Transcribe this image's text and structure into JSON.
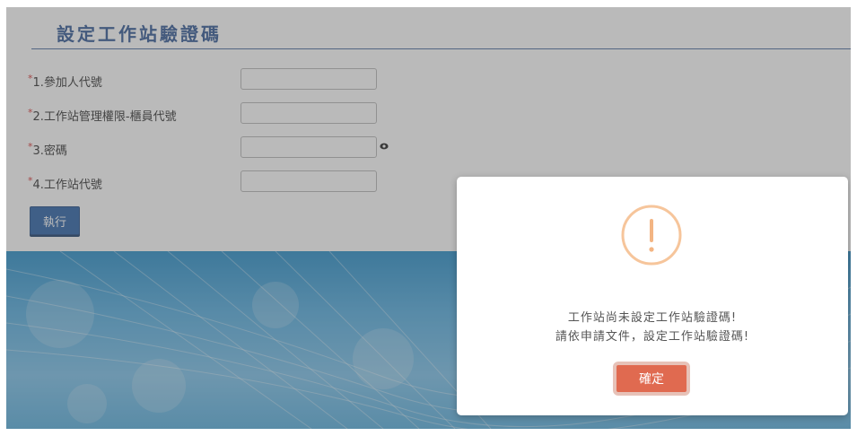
{
  "form": {
    "title": "設定工作站驗證碼",
    "required_marker": "*",
    "fields": [
      {
        "label": "1.參加人代號",
        "value": ""
      },
      {
        "label": "2.工作站管理權限-櫃員代號",
        "value": ""
      },
      {
        "label": "3.密碼",
        "value": ""
      },
      {
        "label": "4.工作站代號",
        "value": ""
      }
    ],
    "execute_label": "執行"
  },
  "dialog": {
    "icon_text": "!",
    "message_line1": "工作站尚未設定工作站驗證碼!",
    "message_line2": "請依申請文件，設定工作站驗證碼!",
    "confirm_label": "確定"
  },
  "colors": {
    "title": "#355b96",
    "execute_button": "#2c63a8",
    "confirm_button": "#e06a50",
    "warning_icon": "#f6c59b",
    "required_marker": "#d63a3a"
  },
  "icons": {
    "password_toggle": "eye-icon",
    "dialog_icon": "warning-icon"
  }
}
